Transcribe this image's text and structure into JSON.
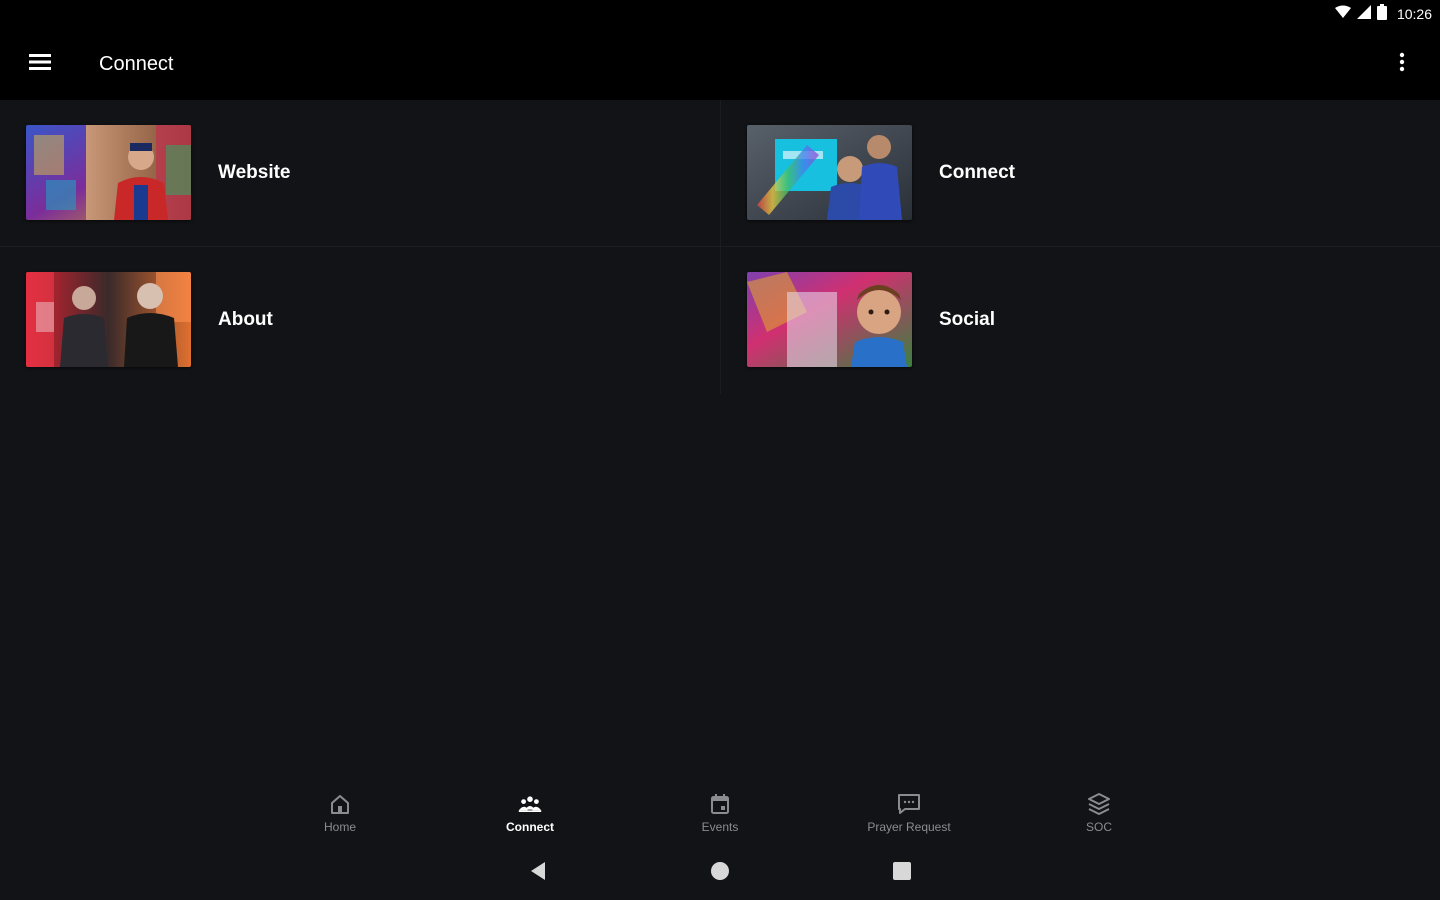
{
  "status_bar": {
    "time": "10:26",
    "icons": [
      "wifi-icon",
      "cell-signal-icon",
      "battery-icon"
    ]
  },
  "app_bar": {
    "title": "Connect",
    "menu_icon": "hamburger-menu-icon",
    "overflow_icon": "more-vert-icon"
  },
  "tiles": [
    {
      "label": "Website",
      "thumb": "photo-website"
    },
    {
      "label": "Connect",
      "thumb": "photo-connect"
    },
    {
      "label": "About",
      "thumb": "photo-about"
    },
    {
      "label": "Social",
      "thumb": "photo-social"
    }
  ],
  "bottom_nav": {
    "active": "Connect",
    "items": [
      {
        "label": "Home",
        "icon": "home-icon"
      },
      {
        "label": "Connect",
        "icon": "people-icon"
      },
      {
        "label": "Events",
        "icon": "calendar-icon"
      },
      {
        "label": "Prayer Request",
        "icon": "chat-icon"
      },
      {
        "label": "SOC",
        "icon": "stack-icon"
      }
    ]
  },
  "system_nav": {
    "icons": [
      "back-icon",
      "home-circle-icon",
      "recents-icon"
    ]
  },
  "colors": {
    "background": "#121316",
    "bar": "#000000",
    "text_primary": "#ffffff",
    "text_secondary": "#8a8c90"
  }
}
